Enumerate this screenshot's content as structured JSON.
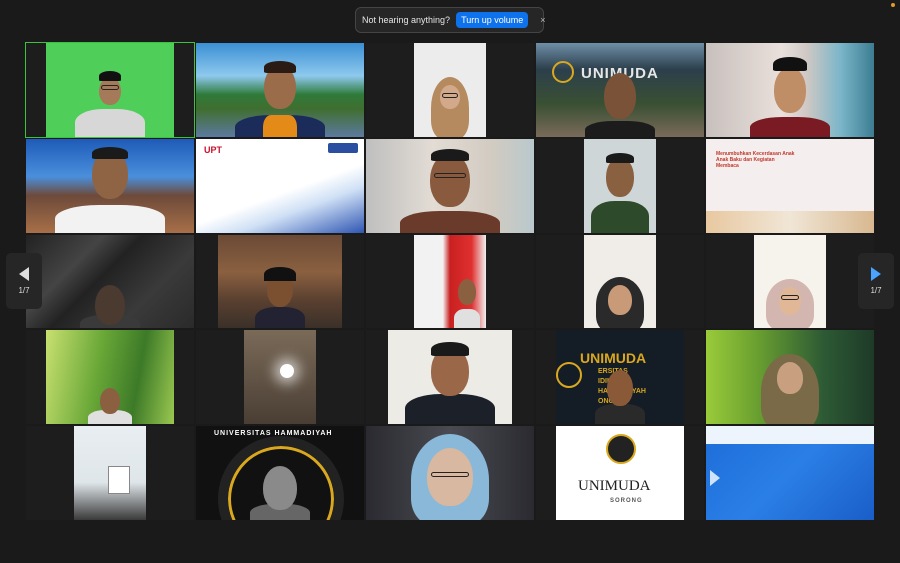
{
  "banner": {
    "message": "Not hearing anything?",
    "button_label": "Turn up volume",
    "close_glyph": "×"
  },
  "nav": {
    "left_page": "1/7",
    "right_page": "1/7"
  },
  "tiles": {
    "t02_logo": "UPT",
    "t04_brand": "UNIMUDA",
    "t14_brand": "UNIMUDA",
    "t14_sub": "ERSITAS",
    "t14_sub2": "IDIKAN",
    "t14_sub3": "HAMMADIYAH",
    "t14_sub4": "ONG",
    "t22_brand": "UNIMUDA",
    "t22_city": "SORONG",
    "t21_arc": "UNIVERSITAS  HAMMADIYAH",
    "t05_title": "Menumbuhkan Kecerdasan Anak Anak Baku dan Kegiatan Membaca"
  },
  "colors": {
    "active_border": "#3cc33c",
    "accent_blue": "#0e72ed",
    "unimuda_gold": "#d9a81e"
  }
}
